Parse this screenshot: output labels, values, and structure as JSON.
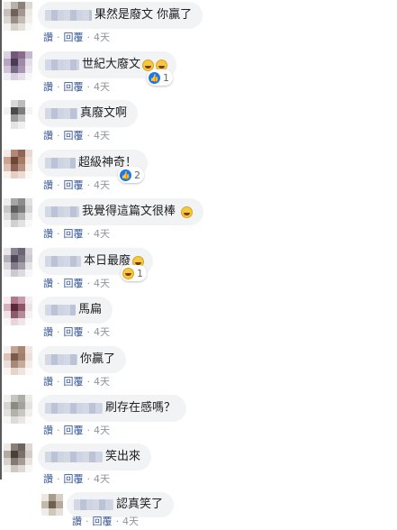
{
  "actions": {
    "like": "讚",
    "reply": "回覆",
    "time": "4天",
    "separator": "·"
  },
  "comments": [
    {
      "text": "果然是廢文 你贏了",
      "emoji": [],
      "reaction": null
    },
    {
      "text": "世紀大廢文",
      "emoji": [
        "laughing-emoji",
        "rofl-emoji"
      ],
      "reaction": {
        "type": "like",
        "count": "1"
      }
    },
    {
      "text": "真廢文啊",
      "emoji": [],
      "reaction": null
    },
    {
      "text": "超級神奇！",
      "emoji": [],
      "reaction": {
        "type": "like",
        "count": "2"
      }
    },
    {
      "text": "我覺得這篇文很棒",
      "emoji": [
        "laughing-emoji"
      ],
      "reaction": null
    },
    {
      "text": "本日最廢",
      "emoji": [
        "laughing-emoji"
      ],
      "reaction": {
        "type": "haha",
        "count": "1"
      }
    },
    {
      "text": "馬扁",
      "emoji": [],
      "reaction": null
    },
    {
      "text": "你贏了",
      "emoji": [],
      "reaction": null
    },
    {
      "text": "刷存在感嗎？",
      "emoji": [],
      "reaction": null
    },
    {
      "text": "笑出來",
      "emoji": [],
      "reaction": null
    }
  ],
  "reply_comment": {
    "text": "認真笑了",
    "emoji": [],
    "reaction": null
  },
  "colors": {
    "bubble": "#f2f3f5",
    "link": "#385898",
    "like": "#1877f2",
    "meta": "#90949c"
  }
}
